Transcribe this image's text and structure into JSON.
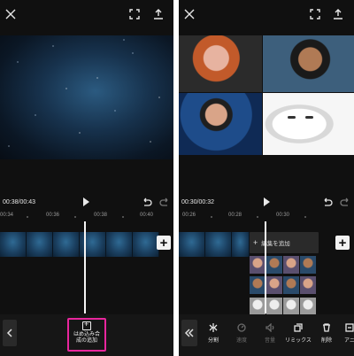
{
  "left": {
    "timecode": "00:38/00:43",
    "ruler_ticks": [
      "00:34",
      "00:36",
      "00:38",
      "00:40"
    ],
    "overlay_button": {
      "line1": "はめ込み合",
      "line2": "成の追加"
    },
    "highlight_color": "#e8269d"
  },
  "right": {
    "timecode": "00:30/00:32",
    "ruler_ticks": [
      "00:26",
      "00:28",
      "00:30"
    ],
    "edit_add_label": "編集を追加",
    "tools": [
      {
        "label": "分割",
        "icon": "split-icon",
        "enabled": true
      },
      {
        "label": "速度",
        "icon": "speed-icon",
        "enabled": false
      },
      {
        "label": "音量",
        "icon": "volume-icon",
        "enabled": false
      },
      {
        "label": "リミックス",
        "icon": "remix-icon",
        "enabled": true
      },
      {
        "label": "削除",
        "icon": "delete-icon",
        "enabled": true
      },
      {
        "label": "アニ",
        "icon": "animation-icon",
        "enabled": true
      }
    ]
  }
}
